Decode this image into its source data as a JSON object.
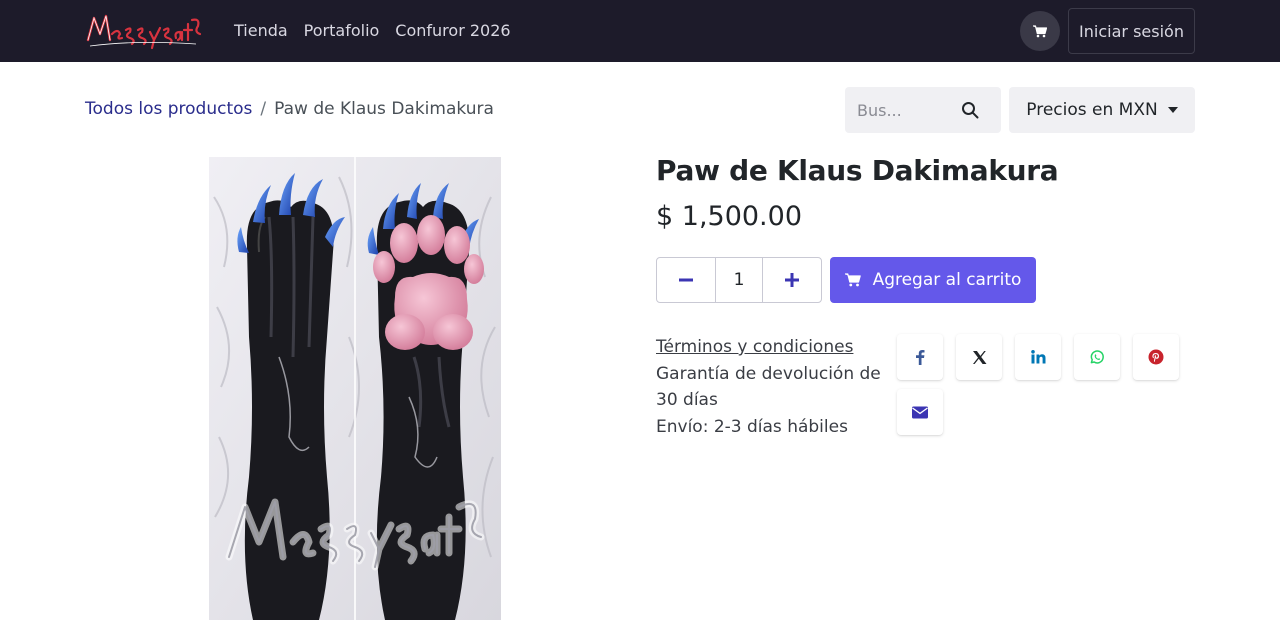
{
  "header": {
    "logo_text": "MeSsySatan",
    "nav": [
      "Tienda",
      "Portafolio",
      "Confuror 2026"
    ],
    "login_label": "Iniciar sesión"
  },
  "breadcrumb": {
    "parent": "Todos los productos",
    "separator": "/",
    "current": "Paw de Klaus Dakimakura"
  },
  "search": {
    "placeholder": "Bus..."
  },
  "currency": {
    "label": "Precios en MXN"
  },
  "product": {
    "title": "Paw de Klaus Dakimakura",
    "price": "$ 1,500.00",
    "quantity": "1",
    "add_to_cart_label": "Agregar al carrito",
    "image_watermark": "MeSsySatan"
  },
  "info": {
    "terms": "Términos y condiciones",
    "guarantee": "Garantía de devolución de 30 días",
    "shipping": "Envío: 2-3 días hábiles"
  },
  "share": {
    "icons": [
      "facebook-icon",
      "x-icon",
      "linkedin-icon",
      "whatsapp-icon",
      "pinterest-icon",
      "email-icon"
    ],
    "colors": {
      "facebook": "#3b5998",
      "x": "#212529",
      "linkedin": "#0077b5",
      "whatsapp": "#25d366",
      "pinterest": "#c8232c",
      "email": "#3b35b3"
    }
  },
  "colors": {
    "header_bg": "#1d1b2a",
    "accent": "#6458ea",
    "link": "#2a2d8c",
    "stepper_icon": "#3b35b3",
    "logo": "#d8333f"
  }
}
